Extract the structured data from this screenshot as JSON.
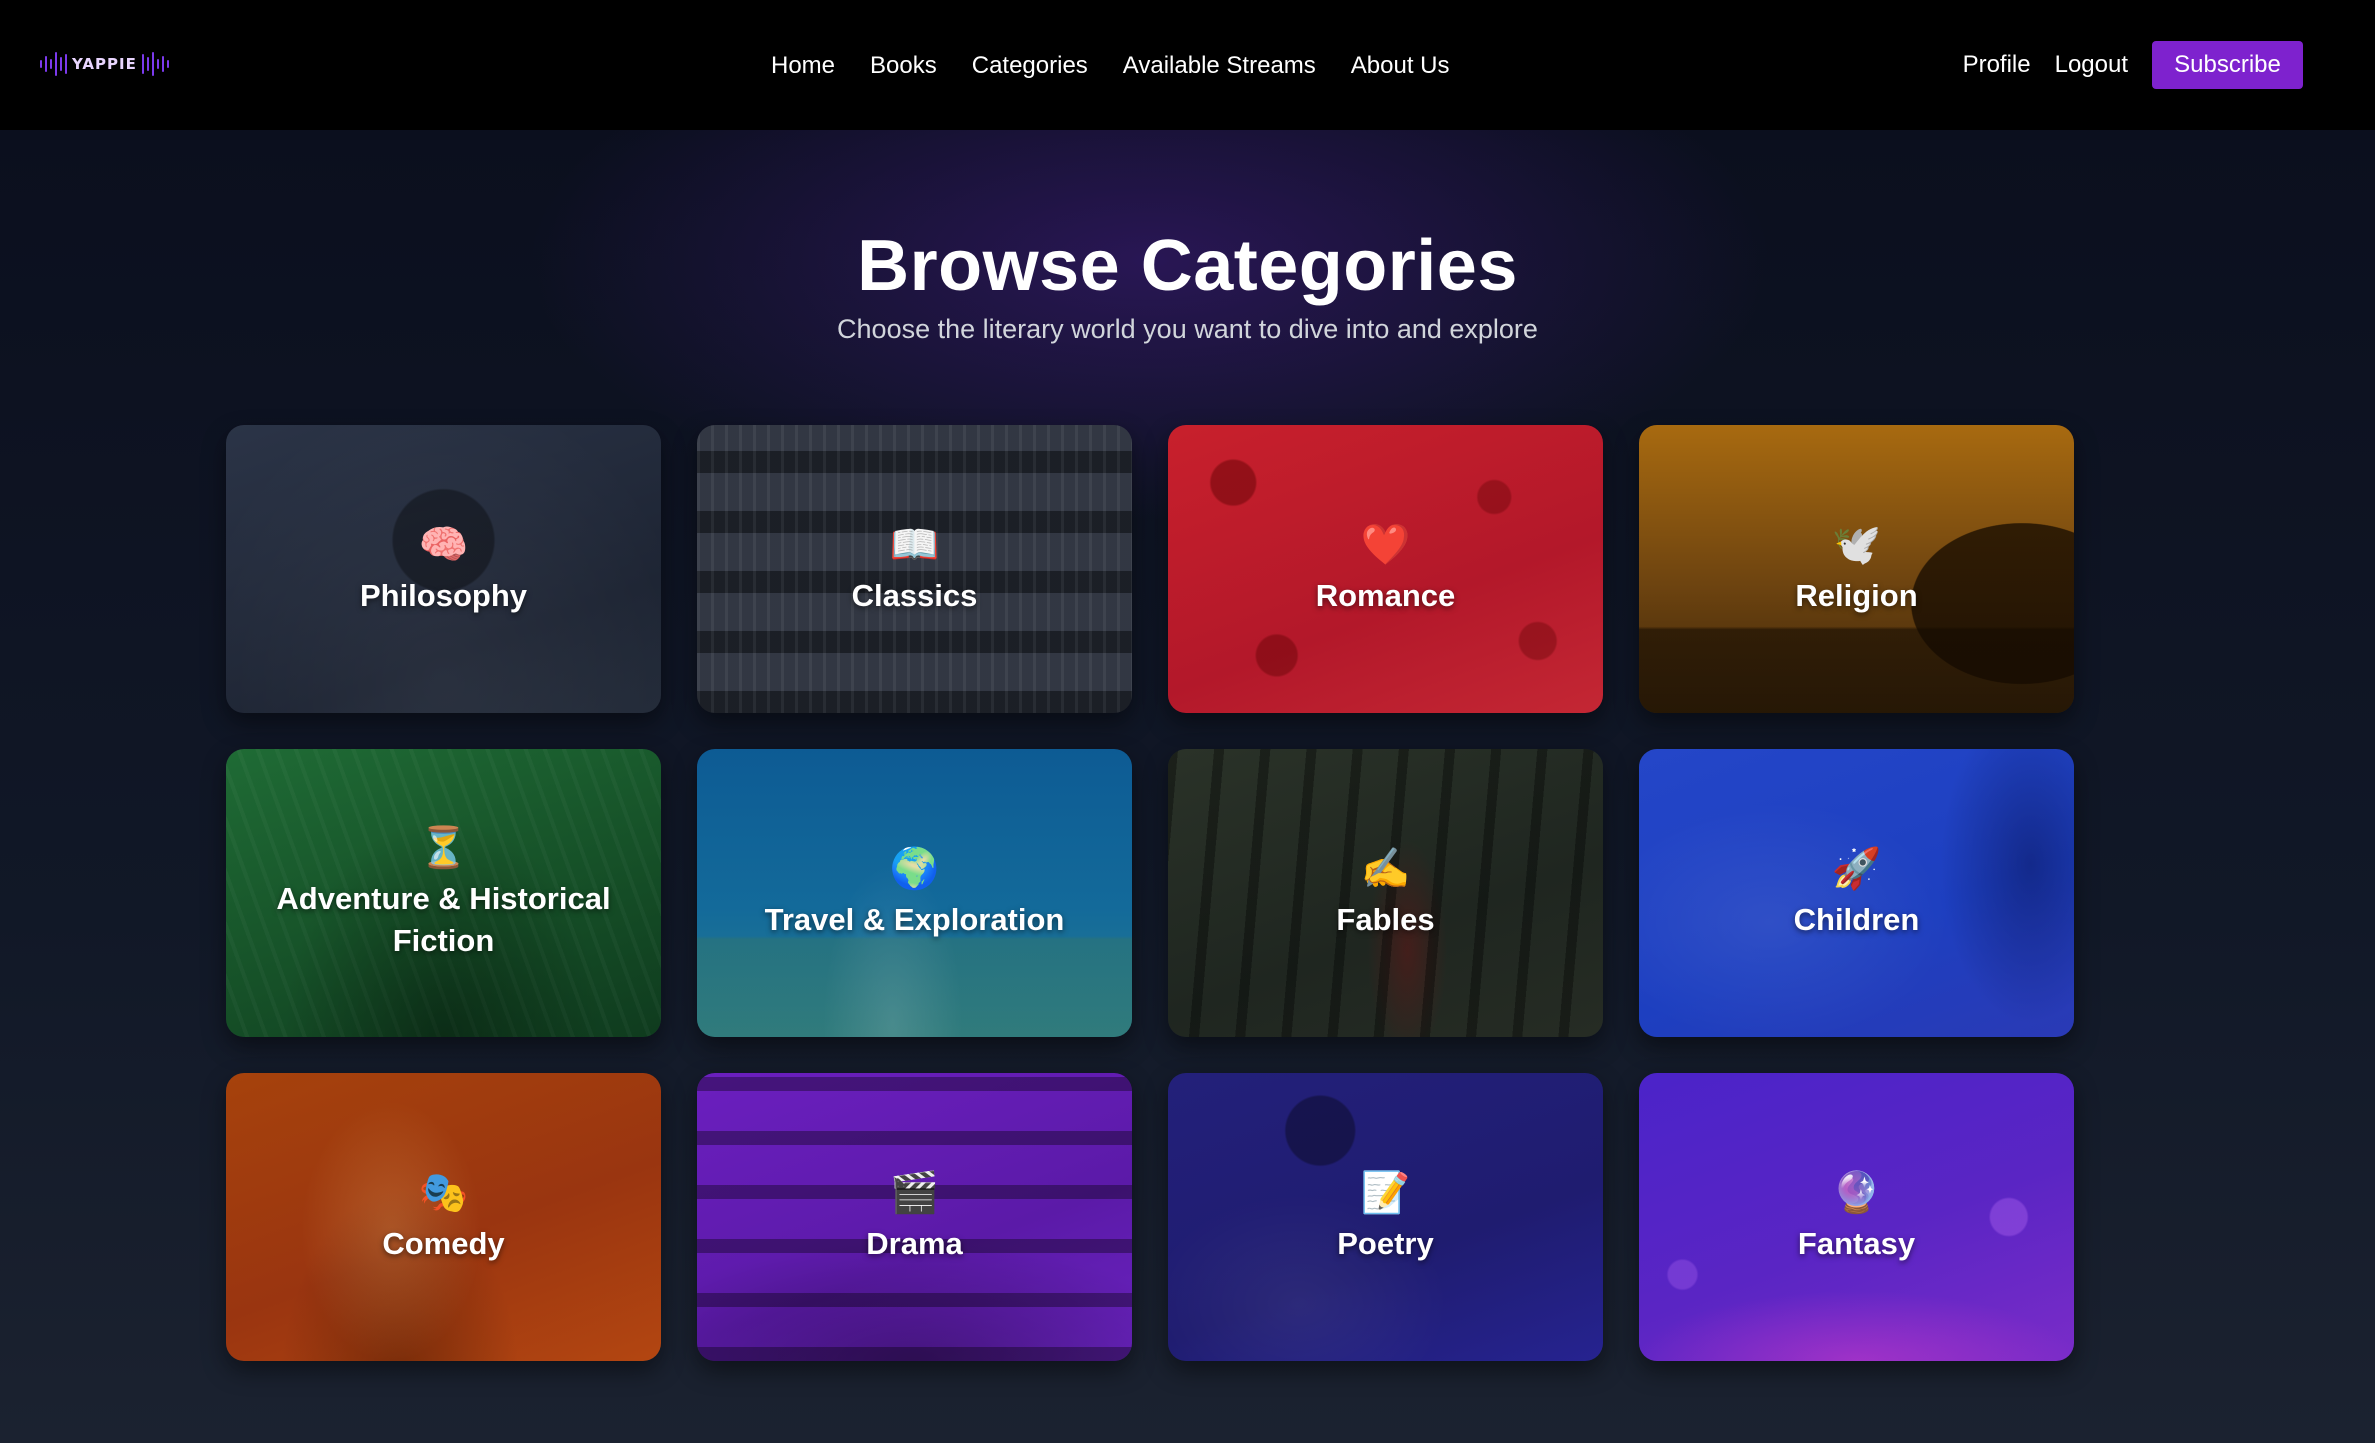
{
  "header": {
    "logo_text": "YAPPIE",
    "nav": [
      {
        "label": "Home"
      },
      {
        "label": "Books"
      },
      {
        "label": "Categories"
      },
      {
        "label": "Available Streams"
      },
      {
        "label": "About Us"
      }
    ],
    "profile_label": "Profile",
    "logout_label": "Logout",
    "subscribe_label": "Subscribe"
  },
  "hero": {
    "title": "Browse Categories",
    "subtitle": "Choose the literary world you want to dive into and explore"
  },
  "categories": [
    {
      "label": "Philosophy",
      "emoji": "🧠"
    },
    {
      "label": "Classics",
      "emoji": "📖"
    },
    {
      "label": "Romance",
      "emoji": "❤️"
    },
    {
      "label": "Religion",
      "emoji": "🕊️"
    },
    {
      "label": "Adventure & Historical Fiction",
      "emoji": "⏳"
    },
    {
      "label": "Travel & Exploration",
      "emoji": "🌍"
    },
    {
      "label": "Fables",
      "emoji": "✍️"
    },
    {
      "label": "Children",
      "emoji": "🚀"
    },
    {
      "label": "Comedy",
      "emoji": "🎭"
    },
    {
      "label": "Drama",
      "emoji": "🎬"
    },
    {
      "label": "Poetry",
      "emoji": "📝"
    },
    {
      "label": "Fantasy",
      "emoji": "🔮"
    }
  ],
  "colors": {
    "accent": "#7e22ce",
    "navbar_bg": "#000000",
    "page_bg": "#0d1220"
  }
}
